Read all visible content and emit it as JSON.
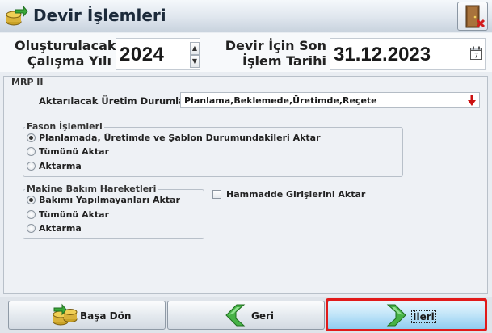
{
  "window": {
    "title": "Devir İşlemleri"
  },
  "header": {
    "year_label": "Oluşturulacak Çalışma Yılı",
    "year_value": "2024",
    "date_label": "Devir İçin Son İşlem Tarihi",
    "date_value": "31.12.2023",
    "calendar_day": "7"
  },
  "mrp": {
    "title": "MRP II",
    "uretim_label": "Aktarılacak Üretim Durumları",
    "uretim_value": "Planlama,Beklemede,Üretimde,Reçete",
    "fason": {
      "title": "Fason İşlemleri",
      "options": [
        {
          "label": "Planlamada, Üretimde ve Şablon Durumundakileri Aktar",
          "checked": true
        },
        {
          "label": "Tümünü Aktar",
          "checked": false
        },
        {
          "label": "Aktarma",
          "checked": false
        }
      ]
    },
    "bakim": {
      "title": "Makine Bakım Hareketleri",
      "options": [
        {
          "label": "Bakımı Yapılmayanları Aktar",
          "checked": true
        },
        {
          "label": "Tümünü Aktar",
          "checked": false
        },
        {
          "label": "Aktarma",
          "checked": false
        }
      ]
    },
    "hammadde_label": "Hammadde Girişlerini Aktar",
    "hammadde_checked": false
  },
  "buttons": {
    "basa_don": "Başa Dön",
    "geri": "Geri",
    "ileri": "İleri"
  },
  "colors": {
    "focus_ring": "#e11a1a",
    "arrow_green": "#3aa83a",
    "combo_arrow": "#cc1111"
  }
}
